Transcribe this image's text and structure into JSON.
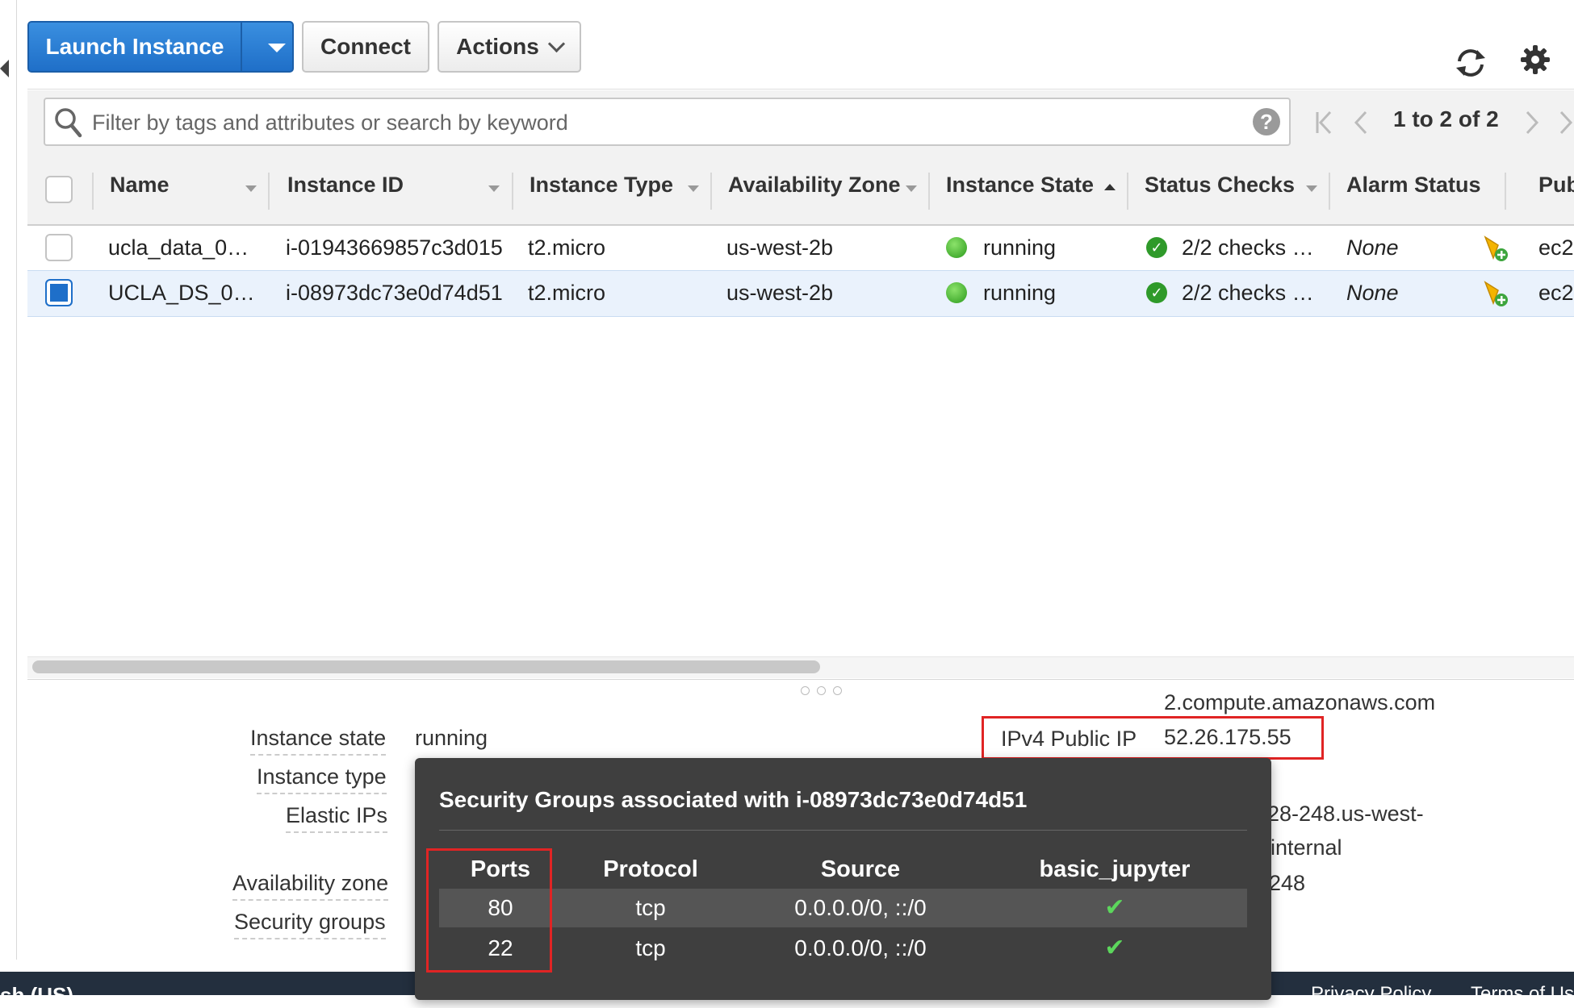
{
  "toolbar": {
    "launch_label": "Launch Instance",
    "connect_label": "Connect",
    "actions_label": "Actions"
  },
  "search": {
    "placeholder": "Filter by tags and attributes or search by keyword",
    "help_glyph": "?"
  },
  "pagination": {
    "text": "1 to 2 of 2"
  },
  "table": {
    "columns": [
      "Name",
      "Instance ID",
      "Instance Type",
      "Availability Zone",
      "Instance State",
      "Status Checks",
      "Alarm Status",
      "Pub"
    ],
    "rows": [
      {
        "name": "ucla_data_0…",
        "instance_id": "i-01943669857c3d015",
        "type": "t2.micro",
        "zone": "us-west-2b",
        "state": "running",
        "checks": "2/2 checks …",
        "alarm": "None",
        "public": "ec2",
        "selected": false
      },
      {
        "name": "UCLA_DS_0…",
        "instance_id": "i-08973dc73e0d74d51",
        "type": "t2.micro",
        "zone": "us-west-2b",
        "state": "running",
        "checks": "2/2 checks …",
        "alarm": "None",
        "public": "ec2",
        "selected": true
      }
    ]
  },
  "details": {
    "instance_state_label": "Instance state",
    "instance_state_value": "running",
    "instance_type_label": "Instance type",
    "elastic_ips_label": "Elastic IPs",
    "availability_zone_label": "Availability zone",
    "security_groups_label": "Security groups",
    "dns_tail": "2.compute.amazonaws.com",
    "ipv4_label": "IPv4 Public IP",
    "ipv4_value": "52.26.175.55",
    "private_dns_partial": "28-248.us-west-",
    "internal_partial": "internal",
    "private_ip_partial": "248"
  },
  "popover": {
    "title": "Security Groups associated with i-08973dc73e0d74d51",
    "headers": [
      "Ports",
      "Protocol",
      "Source",
      "basic_jupyter"
    ],
    "rows": [
      {
        "port": "80",
        "protocol": "tcp",
        "source": "0.0.0.0/0, ::/0",
        "allowed": "✔"
      },
      {
        "port": "22",
        "protocol": "tcp",
        "source": "0.0.0.0/0, ::/0",
        "allowed": "✔"
      }
    ]
  },
  "footer": {
    "left_text": "sh (US)",
    "privacy": "Privacy Policy",
    "terms": "Terms of Us"
  },
  "colors": {
    "primary_button": "#1f6fc8",
    "highlight_box": "#e02424",
    "running_green": "#2b9a1c",
    "popover_bg": "#3f3f3f",
    "footer_bg": "#232f3e"
  }
}
